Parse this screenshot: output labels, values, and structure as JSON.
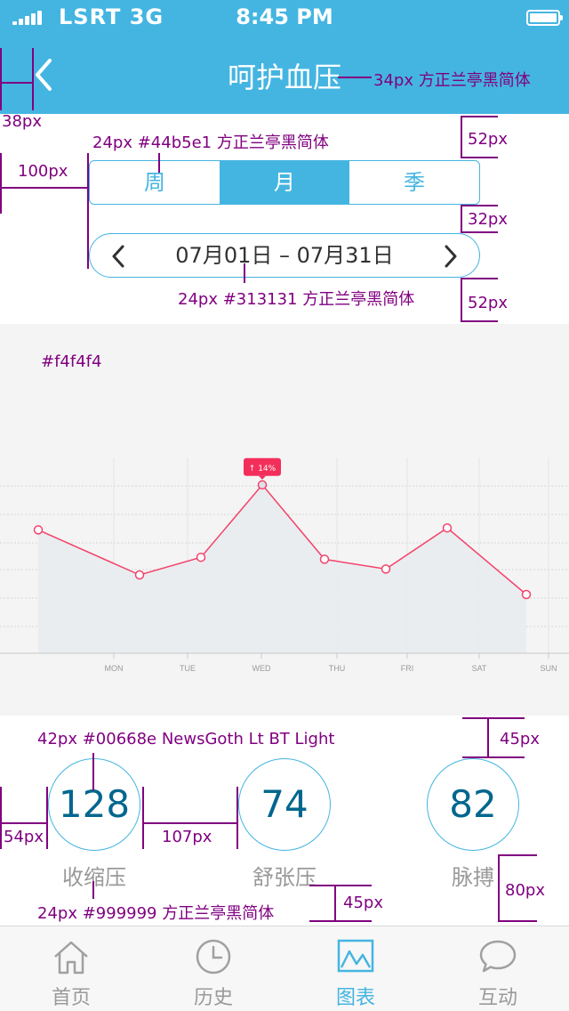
{
  "status_bar": {
    "carrier": "LSRT 3G",
    "time": "8:45 PM"
  },
  "nav": {
    "title": "呵护血压"
  },
  "segment": {
    "tabs": [
      "周",
      "月",
      "季"
    ],
    "active": 1
  },
  "date_range": {
    "text": "07月01日 – 07月31日"
  },
  "chart_data": {
    "type": "line",
    "categories": [
      "",
      "MON",
      "TUE",
      "WED",
      "THU",
      "FRI",
      "SAT",
      "SUN"
    ],
    "values": [
      63,
      40,
      49,
      86,
      48,
      43,
      64,
      30
    ],
    "ylim": [
      0,
      100
    ],
    "grid": true,
    "badge": {
      "text": "↑ 14%",
      "index": 3
    },
    "colors": {
      "line": "#f4426a",
      "area": "#e8ecef",
      "badge": "#f42e5a"
    }
  },
  "stats": [
    {
      "value": "128",
      "label": "收缩压"
    },
    {
      "value": "74",
      "label": "舒张压"
    },
    {
      "value": "82",
      "label": "脉搏"
    }
  ],
  "tabbar": {
    "items": [
      "首页",
      "历史",
      "图表",
      "互动"
    ],
    "active": 2
  },
  "annotations": {
    "a1": "38px",
    "a2": "34px  方正兰亭黑简体",
    "a3": "24px  #44b5e1  方正兰亭黑简体",
    "a4": "52px",
    "a5": "100px",
    "a6": "32px",
    "a7": "24px  #313131  方正兰亭黑简体",
    "a8": "52px",
    "a9": "#f4f4f4",
    "a10": "42px  #00668e  NewsGoth Lt BT Light",
    "a11": "45px",
    "a12": "54px",
    "a13": "107px",
    "a14": "80px",
    "a15": "45px",
    "a16": "24px  #999999  方正兰亭黑简体"
  },
  "colors": {
    "primary": "#44b5e1",
    "text_dark": "#313131",
    "stat_value": "#00668e",
    "stat_label": "#999999",
    "panel_bg": "#f4f4f4",
    "annotation": "#800080"
  }
}
